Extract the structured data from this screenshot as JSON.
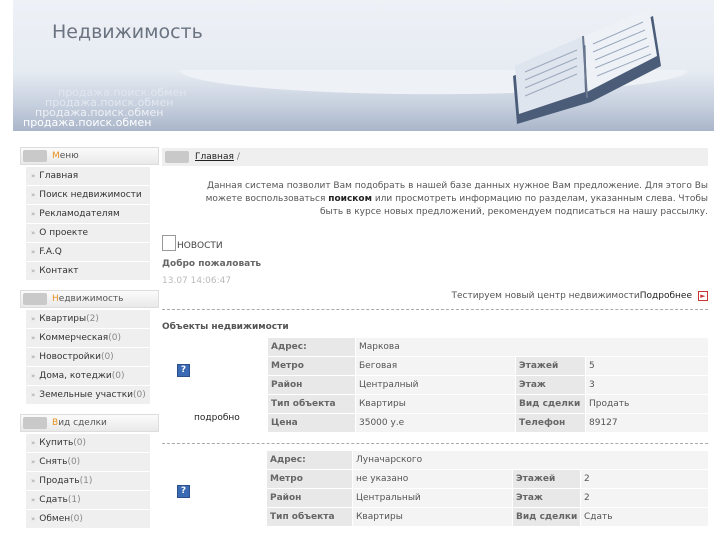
{
  "header": {
    "title": "Недвижимость",
    "slogans": [
      "продажа.поиск.обмен",
      "продажа.поиск.обмен",
      "продажа.поиск.обмен",
      "продажа.поиск.обмен"
    ]
  },
  "sidebar": {
    "menu": {
      "title_first": "М",
      "title_rest": "еню",
      "items": [
        "Главная",
        "Поиск недвижимости",
        "Рекламодателям",
        "О проекте",
        "F.A.Q",
        "Контакт"
      ]
    },
    "realty": {
      "title_first": "Н",
      "title_rest": "едвижимость",
      "items": [
        {
          "label": "Квартиры",
          "count": "(2)"
        },
        {
          "label": "Коммерческая",
          "count": "(0)"
        },
        {
          "label": "Новостройки",
          "count": "(0)"
        },
        {
          "label": "Дома, котеджи",
          "count": "(0)"
        },
        {
          "label": "Земельные участки",
          "count": "(0)"
        }
      ]
    },
    "deal": {
      "title_first": "В",
      "title_rest": "ид сделки",
      "items": [
        {
          "label": "Купить",
          "count": "(0)"
        },
        {
          "label": "Снять",
          "count": "(0)"
        },
        {
          "label": "Продать",
          "count": "(1)"
        },
        {
          "label": "Сдать",
          "count": "(1)"
        },
        {
          "label": "Обмен",
          "count": "(0)"
        }
      ]
    }
  },
  "content": {
    "breadcrumb": {
      "home": "Главная",
      "sep": "/"
    },
    "intro_1": "Данная система позволит Вам подобрать в нашей базе данных нужное Вам предложение. Для этого Вы можете воспользоваться ",
    "intro_bold": "поиском",
    "intro_2": " или просмотреть информацию по разделам, указанным слева. Чтобы быть в курсе новых предложений, рекомендуем подписаться на нашу рассылку.",
    "news_title": "НОВОСТИ",
    "welcome": "Добро пожаловать",
    "date": "13.07 14:06:47",
    "news_text": "Тестируем новый центр недвижимости",
    "news_more": "Подробнее",
    "objects_title": "Объекты недвижимости",
    "more_label": "подробно",
    "labels": {
      "address": "Адрес:",
      "metro": "Метро",
      "district": "Район",
      "type": "Тип объекта",
      "price": "Цена",
      "floors": "Этажей",
      "floor": "Этаж",
      "deal": "Вид сделки",
      "phone": "Телефон"
    },
    "objects": [
      {
        "address": "Маркова",
        "metro": "Беговая",
        "district": "Централный",
        "type": "Квартиры",
        "price": "35000 у.е",
        "floors": "5",
        "floor": "3",
        "deal": "Продать",
        "phone": "89127"
      },
      {
        "address": "Луначарского",
        "metro": "не указано",
        "district": "Центральный",
        "type": "Квартиры",
        "floors": "2",
        "floor": "2",
        "deal": "Сдать"
      }
    ]
  }
}
